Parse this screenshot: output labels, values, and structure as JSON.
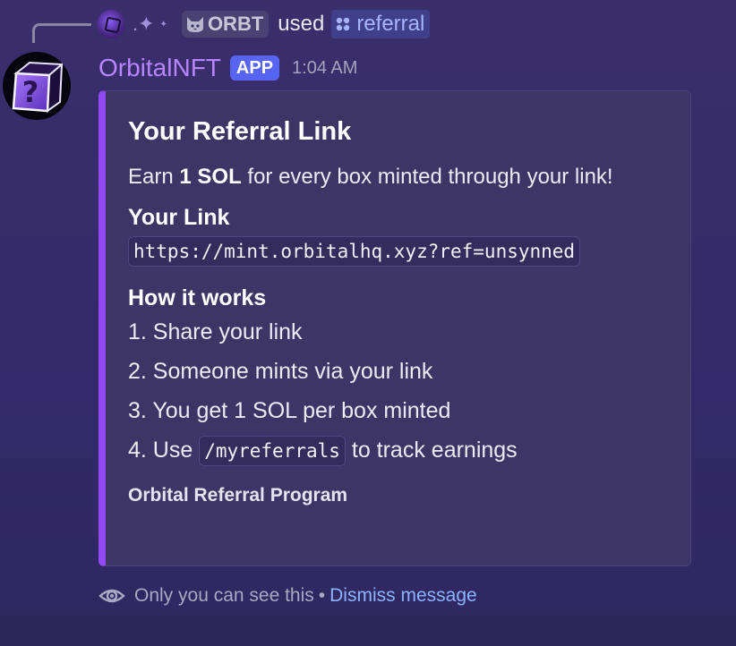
{
  "reply": {
    "guild_tag": "ORBT",
    "used_text": "used",
    "command_name": "referral"
  },
  "message": {
    "username": "OrbitalNFT",
    "badge": "APP",
    "timestamp": "1:04 AM",
    "accent_color": "#9149f3"
  },
  "embed": {
    "title": "Your Referral Link",
    "description_prefix": "Earn ",
    "description_bold": "1 SOL",
    "description_suffix": " for every box minted through your link!",
    "link_field_name": "Your Link",
    "link_value": "https://mint.orbitalhq.xyz?ref=unsynned",
    "how_field_name": "How it works",
    "steps": [
      "1. Share your link",
      "2. Someone mints via your link",
      "3. You get 1 SOL per box minted"
    ],
    "step4_prefix": "4. Use ",
    "step4_code": "/myreferrals",
    "step4_suffix": " to track earnings",
    "footer": "Orbital Referral Program"
  },
  "ephemeral": {
    "note": "Only you can see this",
    "separator": "•",
    "dismiss_label": "Dismiss message"
  },
  "icons": {
    "reply_avatar": "cube-avatar-icon",
    "sparkle": "sparkle-icon",
    "guild_tag": "cat-icon",
    "command": "slash-command-icon",
    "avatar": "question-cube-icon",
    "ephemeral": "eye-icon"
  }
}
